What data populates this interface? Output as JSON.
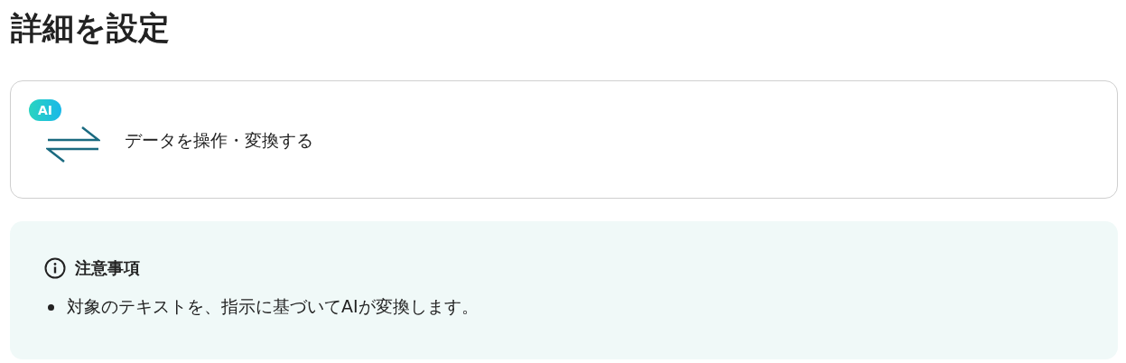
{
  "page_title": "詳細を設定",
  "action_card": {
    "badge": "AI",
    "label": "データを操作・変換する"
  },
  "notice": {
    "title": "注意事項",
    "items": [
      "対象のテキストを、指示に基づいてAIが変換します。"
    ]
  }
}
